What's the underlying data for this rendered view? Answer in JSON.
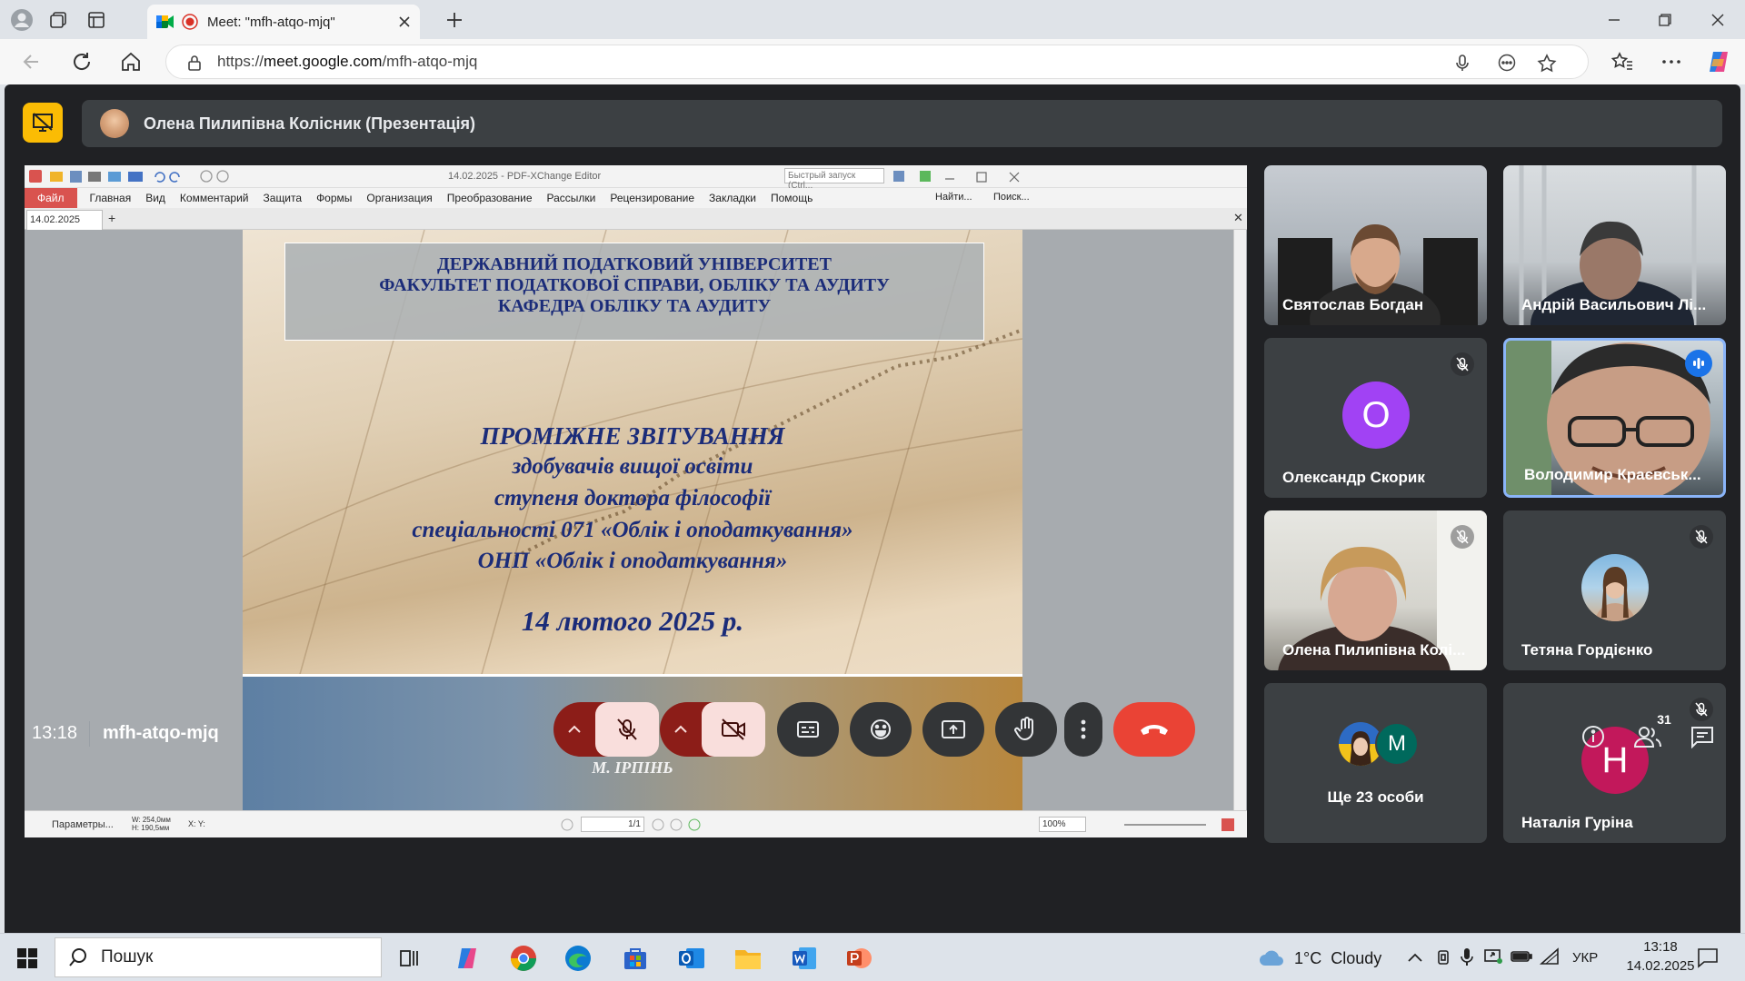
{
  "browser": {
    "tab_title": "Meet: \"mfh-atqo-mjq\"",
    "url_prefix": "https://",
    "url_domain": "meet.google.com",
    "url_path": "/mfh-atqo-mjq"
  },
  "presentation_bar": {
    "presenter": "Олена Пилипівна Колісник (Презентація)"
  },
  "pdf_editor": {
    "window_title": "14.02.2025 - PDF-XChange Editor",
    "quick_launch_placeholder": "Быстрый запуск (Ctrl...",
    "menu": [
      "Файл",
      "Главная",
      "Вид",
      "Комментарий",
      "Защита",
      "Формы",
      "Организация",
      "Преобразование",
      "Рассылки",
      "Рецензирование",
      "Закладки",
      "Помощь"
    ],
    "find_label": "Найти...",
    "search_label": "Поиск...",
    "doc_tab": "14.02.2025",
    "status_params": "Параметры...",
    "status_dims": "W: 254,0мм H: 190,5мм",
    "status_coords": "X: Y:",
    "page_field": "1/1",
    "zoom": "100%"
  },
  "slide": {
    "header": [
      "ДЕРЖАВНИЙ ПОДАТКОВИЙ УНІВЕРСИТЕТ",
      "ФАКУЛЬТЕТ ПОДАТКОВОЇ СПРАВИ, ОБЛІКУ ТА АУДИТУ",
      "КАФЕДРА ОБЛІКУ ТА АУДИТУ"
    ],
    "title": "ПРОМІЖНЕ ЗВІТУВАННЯ",
    "lines": [
      "здобувачів вищої освіти",
      "ступеня доктора філософії",
      "спеціальності 071 «Облік і оподаткування»",
      "ОНП «Облік і оподаткування»"
    ],
    "date": "14 лютого 2025 р.",
    "city": "М. ІРПІНЬ"
  },
  "participants": [
    {
      "name": "Святослав Богдан"
    },
    {
      "name": "Андрій Васильович Лі..."
    },
    {
      "name": "Олександр Скорик",
      "initial": "О",
      "color": "#a142f4"
    },
    {
      "name": "Володимир Краєвськ..."
    },
    {
      "name": "Олена Пилипівна Колі..."
    },
    {
      "name": "Тетяна Гордієнко"
    },
    {
      "name": "Ще 23 особи",
      "initial": "M",
      "color": "#00695c"
    },
    {
      "name": "Наталія Гуріна",
      "initial": "Н",
      "color": "#c2185b"
    }
  ],
  "meeting": {
    "time": "13:18",
    "code": "mfh-atqo-mjq",
    "people_count": "31"
  },
  "taskbar": {
    "search": "Пошук",
    "weather": "1°C  Cloudy",
    "lang": "УКР",
    "time": "13:18",
    "date": "14.02.2025"
  }
}
